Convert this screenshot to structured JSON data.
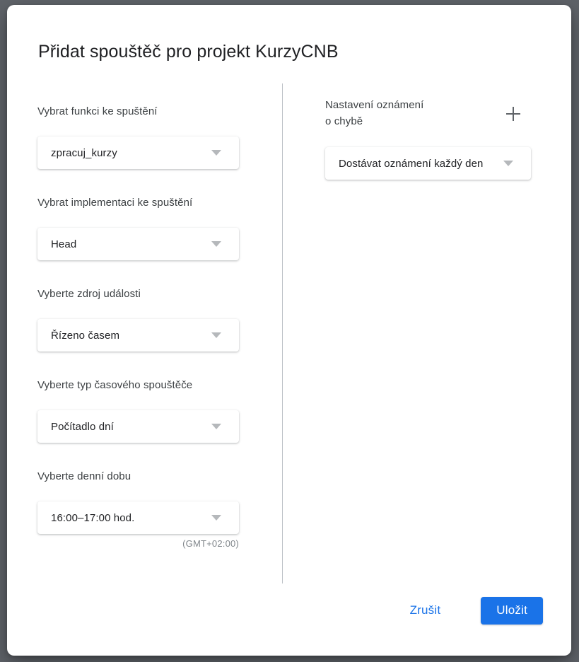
{
  "theme": {
    "backdrop": "#5f6369",
    "dialog_bg": "#ffffff",
    "accent": "#1a73e8",
    "label_color": "#3c4043",
    "value_color": "#202124",
    "hint_color": "#80868b",
    "divider_color": "#bdc1c6",
    "arrow_color": "#b5b8bb",
    "plus_icon_color": "#5f6368"
  },
  "dialog": {
    "title": "Přidat spouštěč pro projekt KurzyCNB",
    "left_column": {
      "fields": [
        {
          "label": "Vybrat funkci ke spuštění",
          "value": "zpracuj_kurzy",
          "icon": "chevron-down-icon"
        },
        {
          "label": "Vybrat implementaci ke spuštění",
          "value": "Head",
          "icon": "chevron-down-icon"
        },
        {
          "label": "Vyberte zdroj události",
          "value": "Řízeno časem",
          "icon": "chevron-down-icon"
        },
        {
          "label": "Vyberte typ časového spouštěče",
          "value": "Počítadlo dní",
          "icon": "chevron-down-icon"
        },
        {
          "label": "Vyberte denní dobu",
          "value": "16:00–17:00 hod.",
          "icon": "chevron-down-icon",
          "hint": "(GMT+02:00)"
        }
      ]
    },
    "right_column": {
      "label_line1": "Nastavení oznámení",
      "label_line2": "o chybě",
      "add_icon": "plus-icon",
      "notification": {
        "value": "Dostávat oznámení každý den",
        "icon": "chevron-down-icon"
      }
    },
    "footer": {
      "cancel_label": "Zrušit",
      "save_label": "Uložit"
    }
  }
}
